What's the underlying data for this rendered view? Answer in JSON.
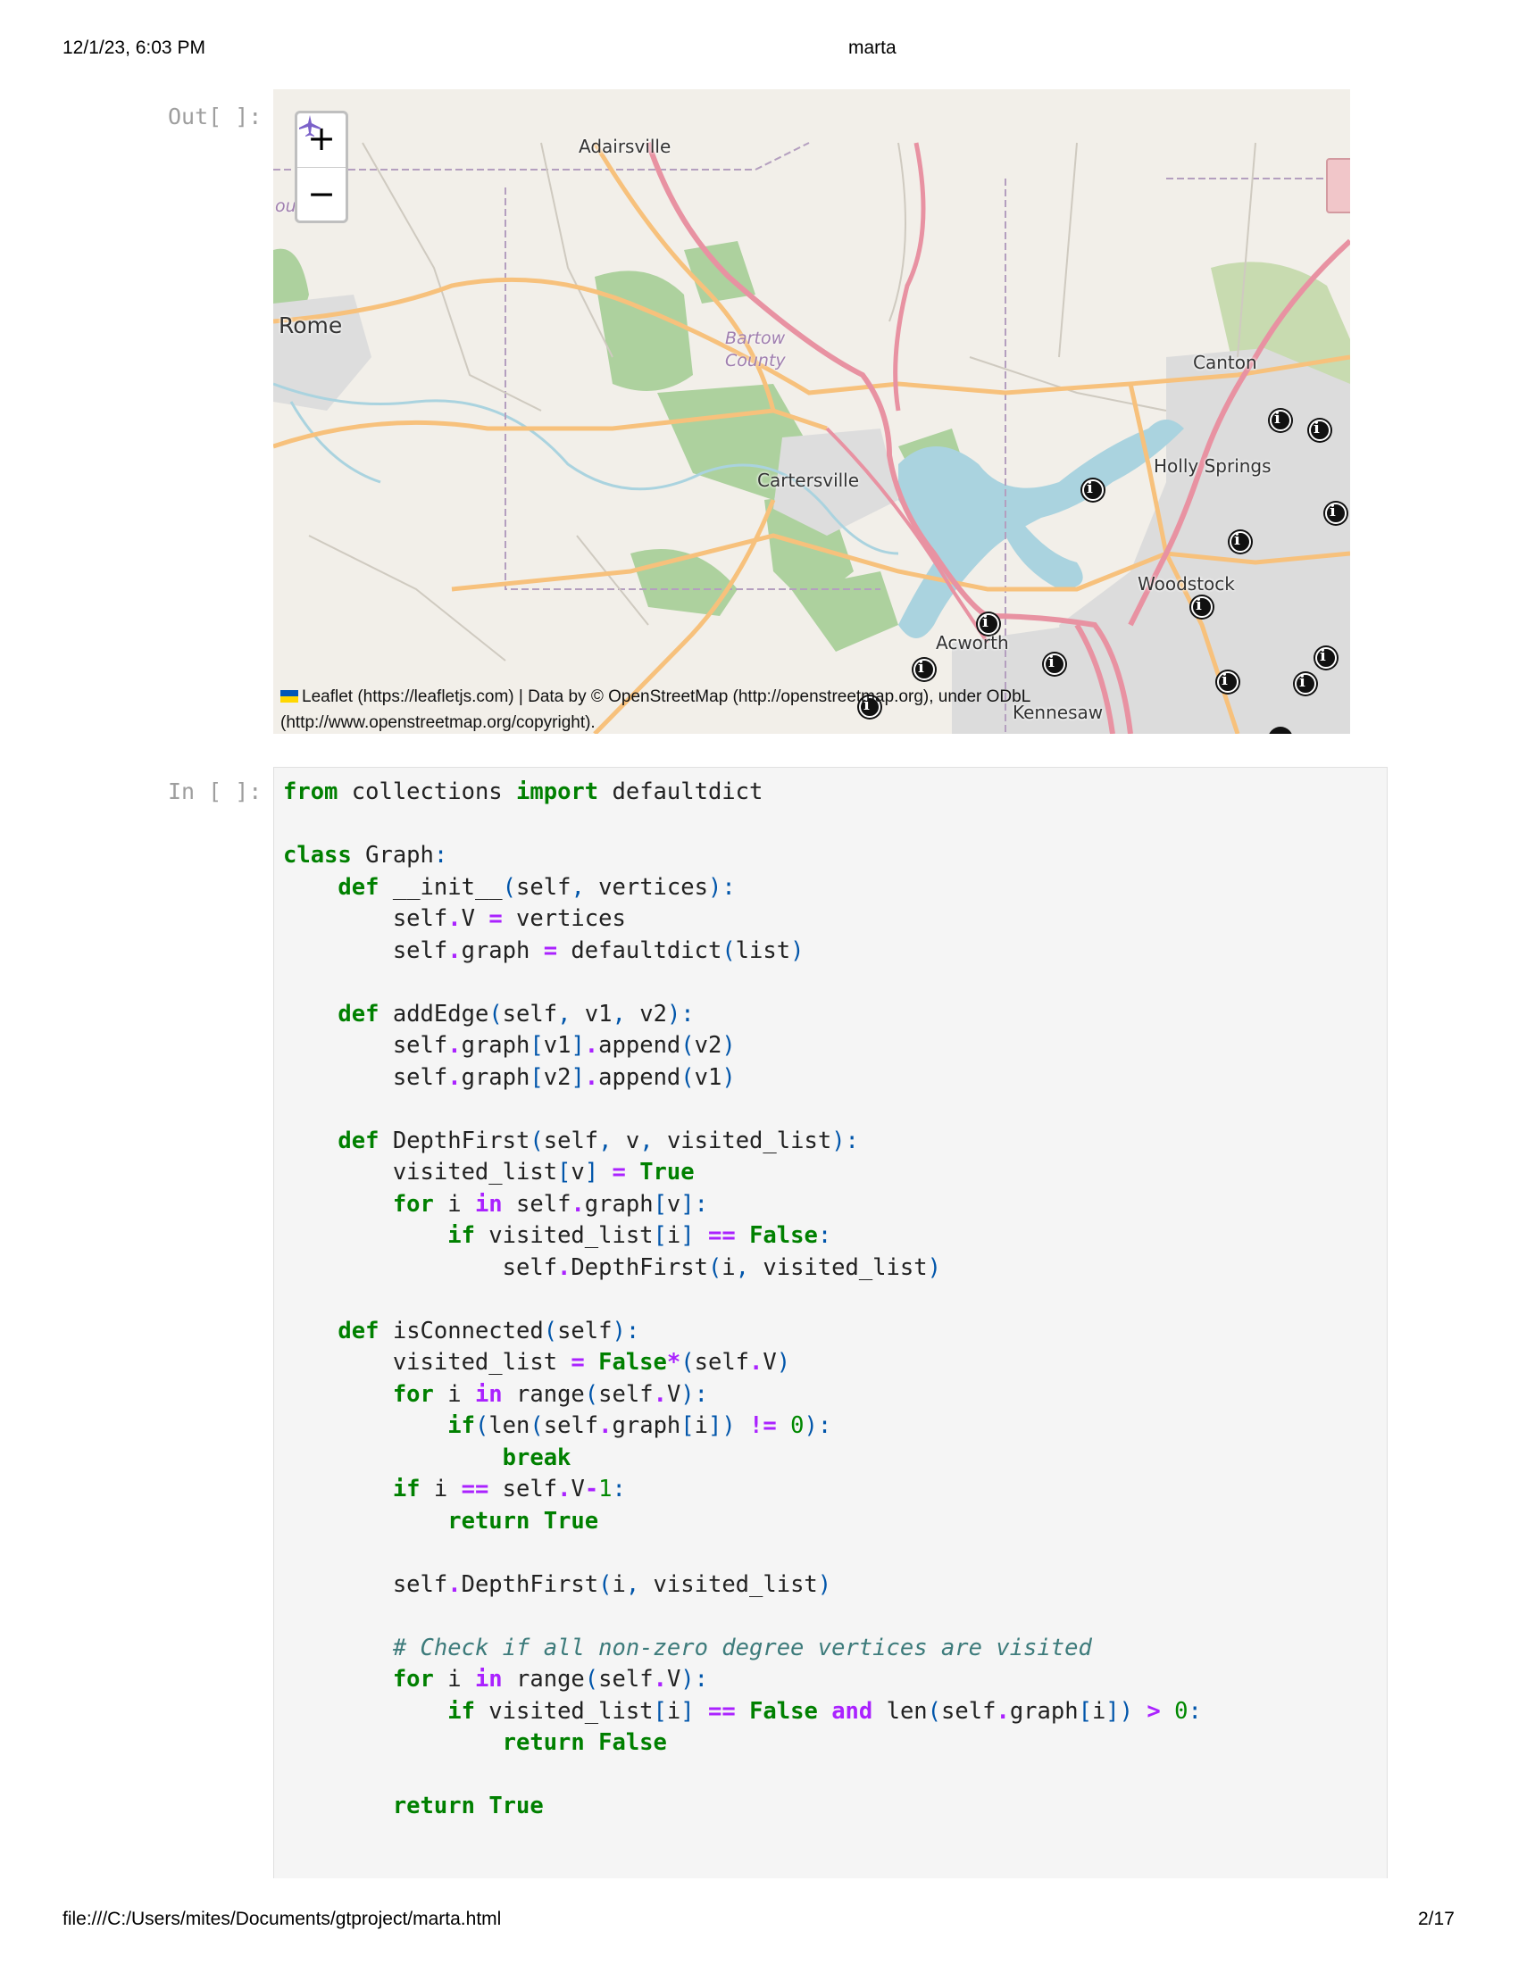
{
  "header": {
    "datetime": "12/1/23, 6:03 PM",
    "title": "marta"
  },
  "footer": {
    "path": "file:///C:/Users/mites/Documents/gtproject/marta.html",
    "page": "2/17"
  },
  "out_prompt": "Out[ ]:",
  "in_prompt": "In [ ]:",
  "map": {
    "zoom_in": "+",
    "zoom_out": "−",
    "labels": {
      "adairsville": "Adairsville",
      "rome": "Rome",
      "county_left": "ounty",
      "bartow": "Bartow",
      "county": "County",
      "cartersville": "Cartersville",
      "canton": "Canton",
      "holly_springs": "Holly Springs",
      "woodstock": "Woodstock",
      "acworth": "Acworth",
      "kennesaw": "Kennesaw"
    },
    "attribution": {
      "line1": "Leaflet (https://leafletjs.com) | Data by © OpenStreetMap (http://openstreetmap.org), under ODbL",
      "line2": "(http://www.openstreetmap.org/copyright)."
    },
    "marker_glyph": "i",
    "colors": {
      "land": "#f2efe9",
      "water": "#aad3df",
      "forest": "#add19e",
      "highway": "#e892a2",
      "primary": "#fcd6a4",
      "urban": "#dddddd"
    }
  },
  "code_lines": [
    [
      [
        "kw",
        "from"
      ],
      [
        "t",
        " collections "
      ],
      [
        "kw",
        "import"
      ],
      [
        "t",
        " defaultdict"
      ]
    ],
    [],
    [
      [
        "kw",
        "class"
      ],
      [
        "t",
        " Graph"
      ],
      [
        "pun",
        ":"
      ]
    ],
    [
      [
        "t",
        "    "
      ],
      [
        "kw",
        "def"
      ],
      [
        "t",
        " __init__"
      ],
      [
        "pun",
        "("
      ],
      [
        "t",
        "self"
      ],
      [
        "pun",
        ","
      ],
      [
        "t",
        " vertices"
      ],
      [
        "pun",
        "):"
      ]
    ],
    [
      [
        "t",
        "        self"
      ],
      [
        "op",
        "."
      ],
      [
        "t",
        "V "
      ],
      [
        "op",
        "="
      ],
      [
        "t",
        " vertices"
      ]
    ],
    [
      [
        "t",
        "        self"
      ],
      [
        "op",
        "."
      ],
      [
        "t",
        "graph "
      ],
      [
        "op",
        "="
      ],
      [
        "t",
        " defaultdict"
      ],
      [
        "pun",
        "("
      ],
      [
        "t",
        "list"
      ],
      [
        "pun",
        ")"
      ]
    ],
    [],
    [
      [
        "t",
        "    "
      ],
      [
        "kw",
        "def"
      ],
      [
        "t",
        " addEdge"
      ],
      [
        "pun",
        "("
      ],
      [
        "t",
        "self"
      ],
      [
        "pun",
        ","
      ],
      [
        "t",
        " v1"
      ],
      [
        "pun",
        ","
      ],
      [
        "t",
        " v2"
      ],
      [
        "pun",
        "):"
      ]
    ],
    [
      [
        "t",
        "        self"
      ],
      [
        "op",
        "."
      ],
      [
        "t",
        "graph"
      ],
      [
        "pun",
        "["
      ],
      [
        "t",
        "v1"
      ],
      [
        "pun",
        "]"
      ],
      [
        "op",
        "."
      ],
      [
        "t",
        "append"
      ],
      [
        "pun",
        "("
      ],
      [
        "t",
        "v2"
      ],
      [
        "pun",
        ")"
      ]
    ],
    [
      [
        "t",
        "        self"
      ],
      [
        "op",
        "."
      ],
      [
        "t",
        "graph"
      ],
      [
        "pun",
        "["
      ],
      [
        "t",
        "v2"
      ],
      [
        "pun",
        "]"
      ],
      [
        "op",
        "."
      ],
      [
        "t",
        "append"
      ],
      [
        "pun",
        "("
      ],
      [
        "t",
        "v1"
      ],
      [
        "pun",
        ")"
      ]
    ],
    [],
    [
      [
        "t",
        "    "
      ],
      [
        "kw",
        "def"
      ],
      [
        "t",
        " DepthFirst"
      ],
      [
        "pun",
        "("
      ],
      [
        "t",
        "self"
      ],
      [
        "pun",
        ","
      ],
      [
        "t",
        " v"
      ],
      [
        "pun",
        ","
      ],
      [
        "t",
        " visited_list"
      ],
      [
        "pun",
        "):"
      ]
    ],
    [
      [
        "t",
        "        visited_list"
      ],
      [
        "pun",
        "["
      ],
      [
        "t",
        "v"
      ],
      [
        "pun",
        "]"
      ],
      [
        "t",
        " "
      ],
      [
        "op",
        "="
      ],
      [
        "t",
        " "
      ],
      [
        "kw",
        "True"
      ]
    ],
    [
      [
        "t",
        "        "
      ],
      [
        "kw",
        "for"
      ],
      [
        "t",
        " i "
      ],
      [
        "op",
        "in"
      ],
      [
        "t",
        " self"
      ],
      [
        "op",
        "."
      ],
      [
        "t",
        "graph"
      ],
      [
        "pun",
        "["
      ],
      [
        "t",
        "v"
      ],
      [
        "pun",
        "]:"
      ]
    ],
    [
      [
        "t",
        "            "
      ],
      [
        "kw",
        "if"
      ],
      [
        "t",
        " visited_list"
      ],
      [
        "pun",
        "["
      ],
      [
        "t",
        "i"
      ],
      [
        "pun",
        "]"
      ],
      [
        "t",
        " "
      ],
      [
        "op",
        "=="
      ],
      [
        "t",
        " "
      ],
      [
        "kw",
        "False"
      ],
      [
        "pun",
        ":"
      ]
    ],
    [
      [
        "t",
        "                self"
      ],
      [
        "op",
        "."
      ],
      [
        "t",
        "DepthFirst"
      ],
      [
        "pun",
        "("
      ],
      [
        "t",
        "i"
      ],
      [
        "pun",
        ","
      ],
      [
        "t",
        " visited_list"
      ],
      [
        "pun",
        ")"
      ]
    ],
    [],
    [
      [
        "t",
        "    "
      ],
      [
        "kw",
        "def"
      ],
      [
        "t",
        " isConnected"
      ],
      [
        "pun",
        "("
      ],
      [
        "t",
        "self"
      ],
      [
        "pun",
        "):"
      ]
    ],
    [
      [
        "t",
        "        visited_list "
      ],
      [
        "op",
        "="
      ],
      [
        "t",
        " "
      ],
      [
        "kw",
        "False"
      ],
      [
        "op",
        "*"
      ],
      [
        "pun",
        "("
      ],
      [
        "t",
        "self"
      ],
      [
        "op",
        "."
      ],
      [
        "t",
        "V"
      ],
      [
        "pun",
        ")"
      ]
    ],
    [
      [
        "t",
        "        "
      ],
      [
        "kw",
        "for"
      ],
      [
        "t",
        " i "
      ],
      [
        "op",
        "in"
      ],
      [
        "t",
        " range"
      ],
      [
        "pun",
        "("
      ],
      [
        "t",
        "self"
      ],
      [
        "op",
        "."
      ],
      [
        "t",
        "V"
      ],
      [
        "pun",
        "):"
      ]
    ],
    [
      [
        "t",
        "            "
      ],
      [
        "kw",
        "if"
      ],
      [
        "pun",
        "("
      ],
      [
        "t",
        "len"
      ],
      [
        "pun",
        "("
      ],
      [
        "t",
        "self"
      ],
      [
        "op",
        "."
      ],
      [
        "t",
        "graph"
      ],
      [
        "pun",
        "["
      ],
      [
        "t",
        "i"
      ],
      [
        "pun",
        "])"
      ],
      [
        "t",
        " "
      ],
      [
        "op",
        "!="
      ],
      [
        "t",
        " "
      ],
      [
        "num",
        "0"
      ],
      [
        "pun",
        "):"
      ]
    ],
    [
      [
        "t",
        "                "
      ],
      [
        "kw",
        "break"
      ]
    ],
    [
      [
        "t",
        "        "
      ],
      [
        "kw",
        "if"
      ],
      [
        "t",
        " i "
      ],
      [
        "op",
        "=="
      ],
      [
        "t",
        " self"
      ],
      [
        "op",
        "."
      ],
      [
        "t",
        "V"
      ],
      [
        "op",
        "-"
      ],
      [
        "num",
        "1"
      ],
      [
        "pun",
        ":"
      ]
    ],
    [
      [
        "t",
        "            "
      ],
      [
        "kw",
        "return"
      ],
      [
        "t",
        " "
      ],
      [
        "kw",
        "True"
      ]
    ],
    [],
    [
      [
        "t",
        "        self"
      ],
      [
        "op",
        "."
      ],
      [
        "t",
        "DepthFirst"
      ],
      [
        "pun",
        "("
      ],
      [
        "t",
        "i"
      ],
      [
        "pun",
        ","
      ],
      [
        "t",
        " visited_list"
      ],
      [
        "pun",
        ")"
      ]
    ],
    [],
    [
      [
        "t",
        "        "
      ],
      [
        "cm",
        "# Check if all non-zero degree vertices are visited"
      ]
    ],
    [
      [
        "t",
        "        "
      ],
      [
        "kw",
        "for"
      ],
      [
        "t",
        " i "
      ],
      [
        "op",
        "in"
      ],
      [
        "t",
        " range"
      ],
      [
        "pun",
        "("
      ],
      [
        "t",
        "self"
      ],
      [
        "op",
        "."
      ],
      [
        "t",
        "V"
      ],
      [
        "pun",
        "):"
      ]
    ],
    [
      [
        "t",
        "            "
      ],
      [
        "kw",
        "if"
      ],
      [
        "t",
        " visited_list"
      ],
      [
        "pun",
        "["
      ],
      [
        "t",
        "i"
      ],
      [
        "pun",
        "]"
      ],
      [
        "t",
        " "
      ],
      [
        "op",
        "=="
      ],
      [
        "t",
        " "
      ],
      [
        "kw",
        "False"
      ],
      [
        "t",
        " "
      ],
      [
        "op",
        "and"
      ],
      [
        "t",
        " len"
      ],
      [
        "pun",
        "("
      ],
      [
        "t",
        "self"
      ],
      [
        "op",
        "."
      ],
      [
        "t",
        "graph"
      ],
      [
        "pun",
        "["
      ],
      [
        "t",
        "i"
      ],
      [
        "pun",
        "])"
      ],
      [
        "t",
        " "
      ],
      [
        "op",
        ">"
      ],
      [
        "t",
        " "
      ],
      [
        "num",
        "0"
      ],
      [
        "pun",
        ":"
      ]
    ],
    [
      [
        "t",
        "                "
      ],
      [
        "kw",
        "return"
      ],
      [
        "t",
        " "
      ],
      [
        "kw",
        "False"
      ]
    ],
    [],
    [
      [
        "t",
        "        "
      ],
      [
        "kw",
        "return"
      ],
      [
        "t",
        " "
      ],
      [
        "kw",
        "True"
      ]
    ]
  ]
}
